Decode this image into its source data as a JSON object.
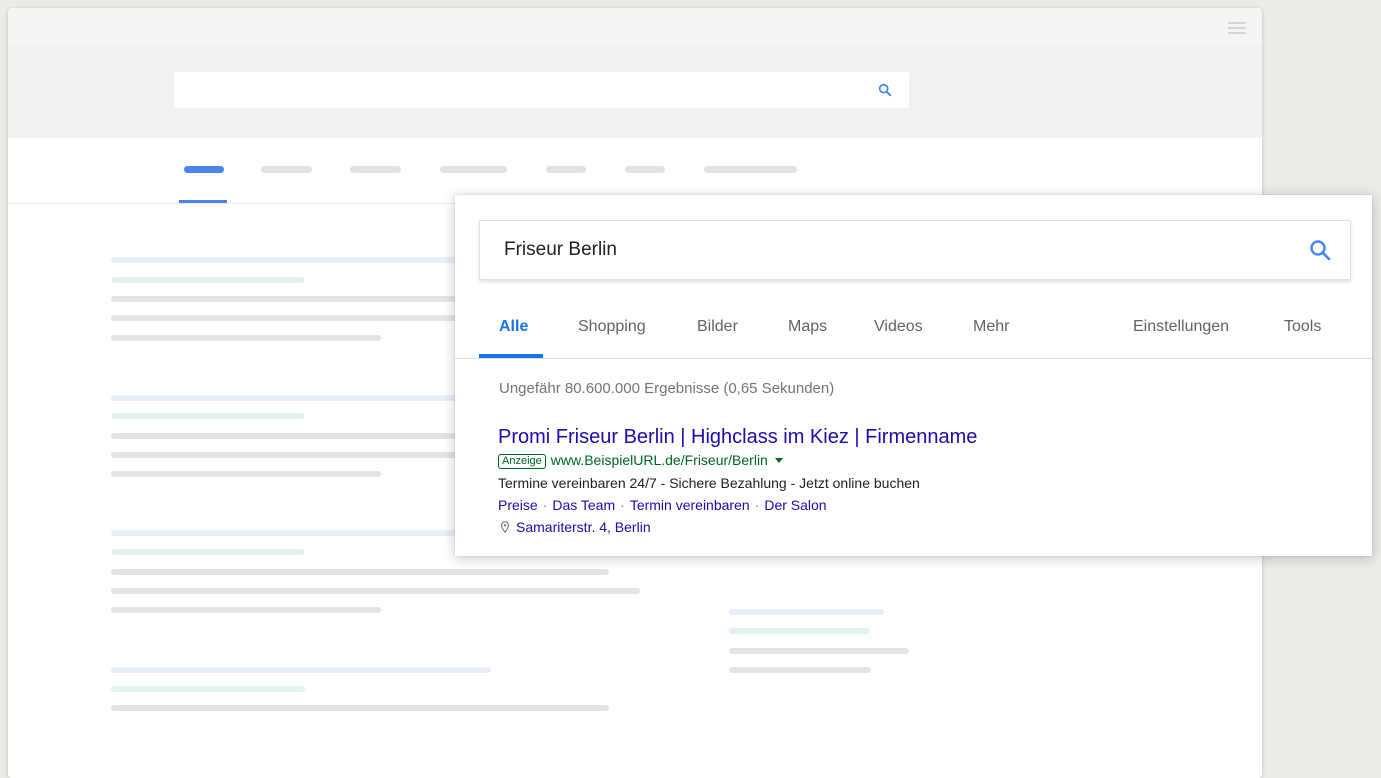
{
  "search": {
    "query": "Friseur Berlin"
  },
  "tabs": [
    {
      "label": "Alle",
      "active": true
    },
    {
      "label": "Shopping"
    },
    {
      "label": "Bilder"
    },
    {
      "label": "Maps"
    },
    {
      "label": "Videos"
    },
    {
      "label": "Mehr"
    },
    {
      "label": "Einstellungen"
    },
    {
      "label": "Tools"
    }
  ],
  "result_stats": "Ungefähr 80.600.000 Ergebnisse (0,65 Sekunden)",
  "ad": {
    "title": "Promi Friseur Berlin | Highclass im Kiez | Firmenname",
    "badge": "Anzeige",
    "url": "www.BeispielURL.de/Friseur/Berlin",
    "description": "Termine vereinbaren 24/7 - Sichere Bezahlung - Jetzt online buchen",
    "sitelinks": [
      "Preise",
      "Das Team",
      "Termin vereinbaren",
      "Der Salon"
    ],
    "sitelink_separator": "·",
    "location": "Samariterstr. 4, Berlin"
  },
  "icons": {
    "search": "search-icon",
    "menu": "hamburger-menu-icon",
    "location": "map-pin-icon",
    "dropdown": "caret-down-icon"
  },
  "colors": {
    "accent": "#1a73e8",
    "link": "#1a0dab",
    "url_green": "#006621",
    "background": "#ebebe8"
  }
}
